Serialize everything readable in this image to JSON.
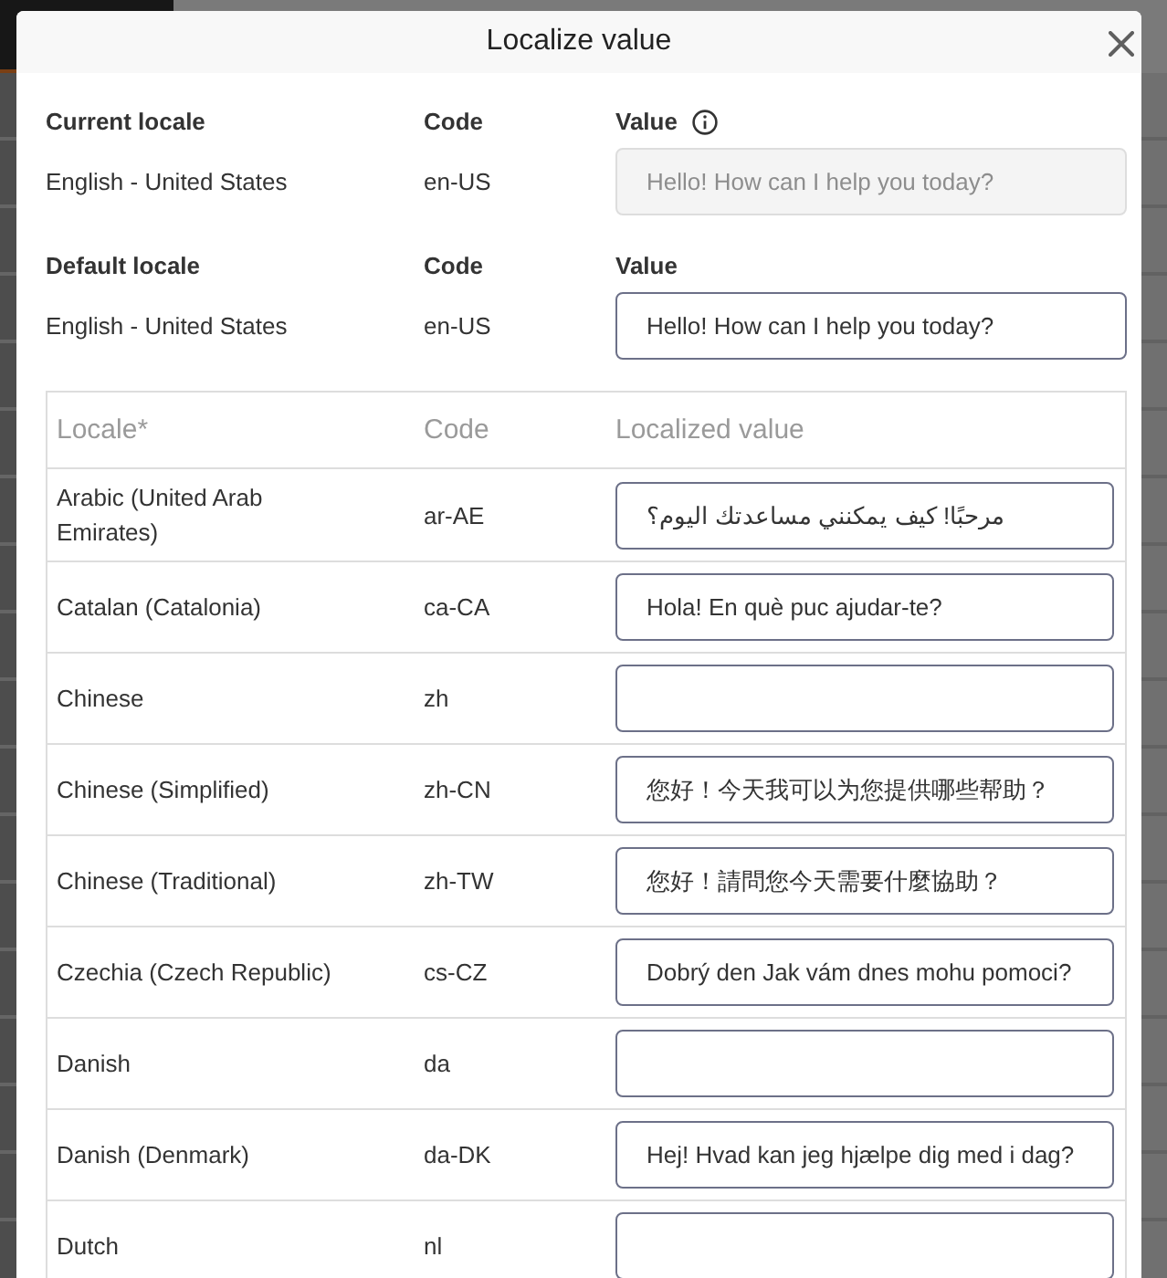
{
  "dialog": {
    "title": "Localize value"
  },
  "locale_sections": [
    {
      "heading": "Current locale",
      "code_heading": "Code",
      "value_heading": "Value",
      "info_icon": true,
      "locale": "English - United States",
      "code": "en-US",
      "value": "Hello! How can I help you today?",
      "disabled": true
    },
    {
      "heading": "Default locale",
      "code_heading": "Code",
      "value_heading": "Value",
      "locale": "English - United States",
      "code": "en-US",
      "value": "Hello! How can I help you today?",
      "disabled": false
    }
  ],
  "table": {
    "columns": [
      "Locale*",
      "Code",
      "Localized value"
    ],
    "rows": [
      {
        "locale": "Arabic (United Arab Emirates)",
        "code": "ar-AE",
        "value": "مرحبًا! كيف يمكنني مساعدتك اليوم؟"
      },
      {
        "locale": "Catalan (Catalonia)",
        "code": "ca-CA",
        "value": "Hola! En què puc ajudar-te?"
      },
      {
        "locale": "Chinese",
        "code": "zh"
      },
      {
        "locale": "Chinese (Simplified)",
        "code": "zh-CN",
        "value": "您好！今天我可以为您提供哪些帮助？"
      },
      {
        "locale": "Chinese (Traditional)",
        "code": "zh-TW",
        "value": "您好！請問您今天需要什麼協助？"
      },
      {
        "locale": "Czechia (Czech Republic)",
        "code": "cs-CZ",
        "value": "Dobrý den Jak vám dnes mohu pomoci?"
      },
      {
        "locale": "Danish",
        "code": "da"
      },
      {
        "locale": "Danish (Denmark)",
        "code": "da-DK",
        "value": "Hej! Hvad kan jeg hjælpe dig med i dag?"
      },
      {
        "locale": "Dutch",
        "code": "nl"
      }
    ]
  }
}
